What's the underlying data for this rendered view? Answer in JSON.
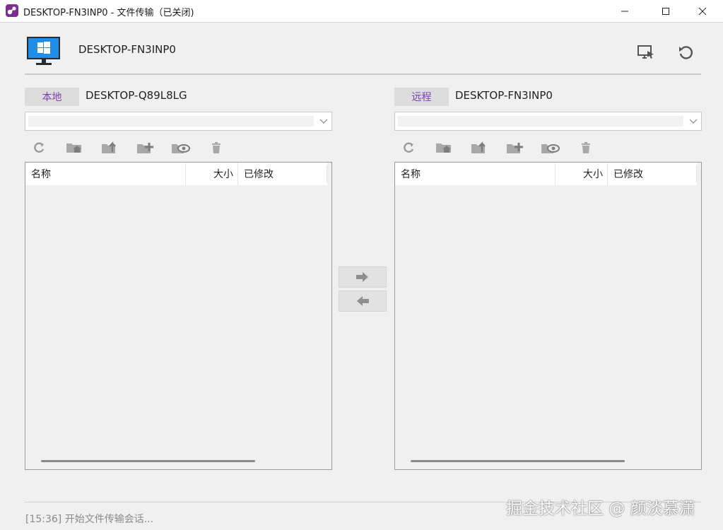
{
  "window": {
    "title": "DESKTOP-FN3INP0 - 文件传输（已关闭)",
    "minimize_icon": "minimize-icon",
    "maximize_icon": "maximize-icon",
    "close_icon": "close-icon"
  },
  "header": {
    "host": "DESKTOP-FN3INP0",
    "icon": "windows-monitor-icon",
    "buttons": [
      "remote-screen-icon",
      "refresh-reconnect-icon"
    ]
  },
  "local": {
    "badge": "本地",
    "host": "DESKTOP-Q89L8LG",
    "path_value": "",
    "columns": {
      "name": "名称",
      "size": "大小",
      "modified": "已修改"
    },
    "rows": []
  },
  "remote": {
    "badge": "远程",
    "host": "DESKTOP-FN3INP0",
    "path_value": "",
    "columns": {
      "name": "名称",
      "size": "大小",
      "modified": "已修改"
    },
    "rows": []
  },
  "toolbar_icons": [
    "refresh-icon",
    "home-folder-icon",
    "up-folder-icon",
    "new-folder-icon",
    "show-hidden-icon",
    "delete-icon"
  ],
  "transfer": {
    "send_icon": "arrow-right-icon",
    "receive_icon": "arrow-left-icon"
  },
  "status": {
    "text": "[15:36] 开始文件传输会话..."
  },
  "watermark": "掘金技术社区 @ 颜淡慕潇",
  "colors": {
    "accent": "#7a3fb0",
    "badge_bg": "#dcdcdc",
    "window_bg": "#f0f0f0"
  }
}
